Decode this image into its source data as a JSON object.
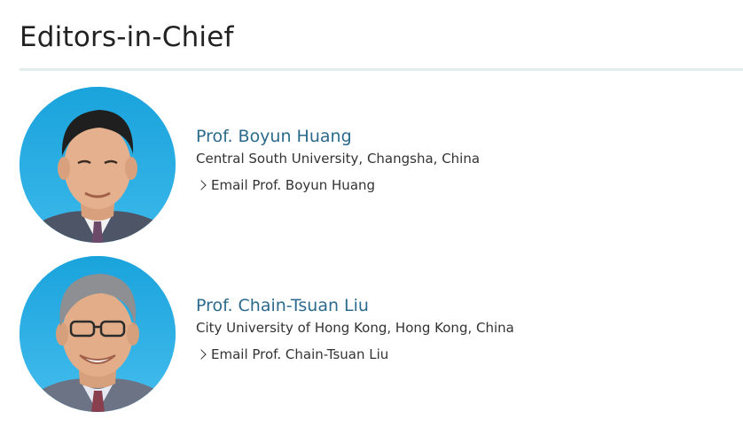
{
  "section": {
    "title": "Editors-in-Chief"
  },
  "editors": [
    {
      "name": "Prof. Boyun Huang",
      "affiliation": "Central South University, Changsha, China",
      "email_label": "Email Prof. Boyun Huang"
    },
    {
      "name": "Prof. Chain-Tsuan Liu",
      "affiliation": "City University of Hong Kong, Hong Kong, China",
      "email_label": "Email Prof. Chain-Tsuan Liu"
    }
  ],
  "icons": {
    "email_link": "chevron-right-icon"
  },
  "colors": {
    "name_link": "#2b6a8c",
    "divider": "#e1eeec",
    "photo_background": "#1ea7df"
  }
}
